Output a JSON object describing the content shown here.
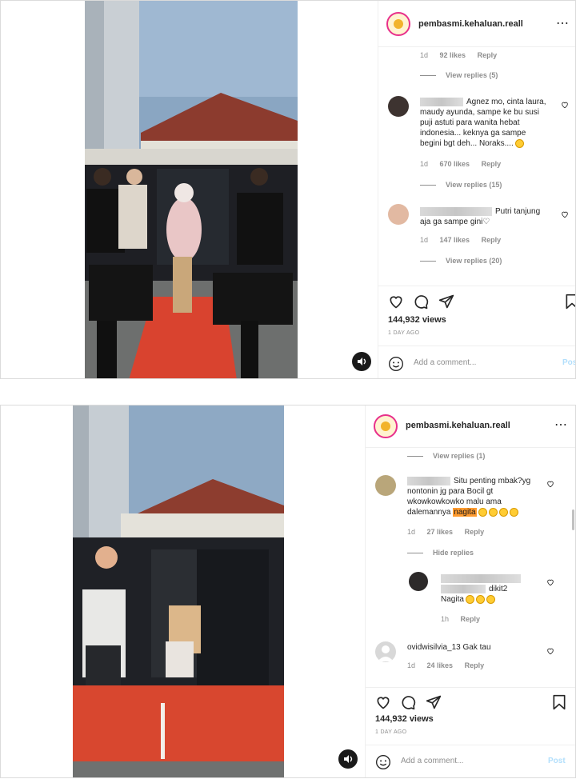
{
  "posts": [
    {
      "username": "pembasmi.kehaluan.reall",
      "comments_top": {
        "time": "1d",
        "likes": "92 likes",
        "reply": "Reply",
        "view_replies": "View replies (5)"
      },
      "comments": [
        {
          "text": "Agnez mo, cinta laura, maudy ayunda, sampe ke bu susi puji astuti para wanita hebat indonesia... keknya ga sampe begini bgt deh... Noraks....",
          "time": "1d",
          "likes": "670 likes",
          "reply": "Reply",
          "view_replies": "View replies (15)"
        },
        {
          "text": "Putri tanjung aja ga sampe gini♡",
          "time": "1d",
          "likes": "147 likes",
          "reply": "Reply",
          "view_replies": "View replies (20)"
        }
      ],
      "views": "144,932 views",
      "ago": "1 DAY AGO",
      "add_comment_placeholder": "Add a comment...",
      "post_label": "Post"
    },
    {
      "username": "pembasmi.kehaluan.reall",
      "comments_top": {
        "view_replies": "View replies (1)"
      },
      "comments": [
        {
          "text_a": "Situ penting mbak?yg nontonin jg para Bocil gt wkowkowkowko malu ama dalemannya",
          "highlight": "nagita",
          "time": "1d",
          "likes": "27 likes",
          "reply": "Reply",
          "hide_replies": "Hide replies"
        },
        {
          "text_a": "dikit2",
          "text_b": "Nagita",
          "time": "1h",
          "reply": "Reply"
        },
        {
          "username": "ovidwisilvia_13",
          "text": "Gak tau",
          "time": "1d",
          "likes": "24 likes",
          "reply": "Reply"
        }
      ],
      "views": "144,932 views",
      "ago": "1 DAY AGO",
      "add_comment_placeholder": "Add a comment...",
      "post_label": "Post"
    }
  ],
  "icons": [
    "heart-icon",
    "comment-icon",
    "share-icon",
    "bookmark-icon",
    "emoji-icon",
    "sound-icon",
    "more-icon"
  ],
  "colors": {
    "accent_post": "#b2dffc",
    "highlight": "#ff9b2f",
    "muted": "#8e8e8e"
  }
}
